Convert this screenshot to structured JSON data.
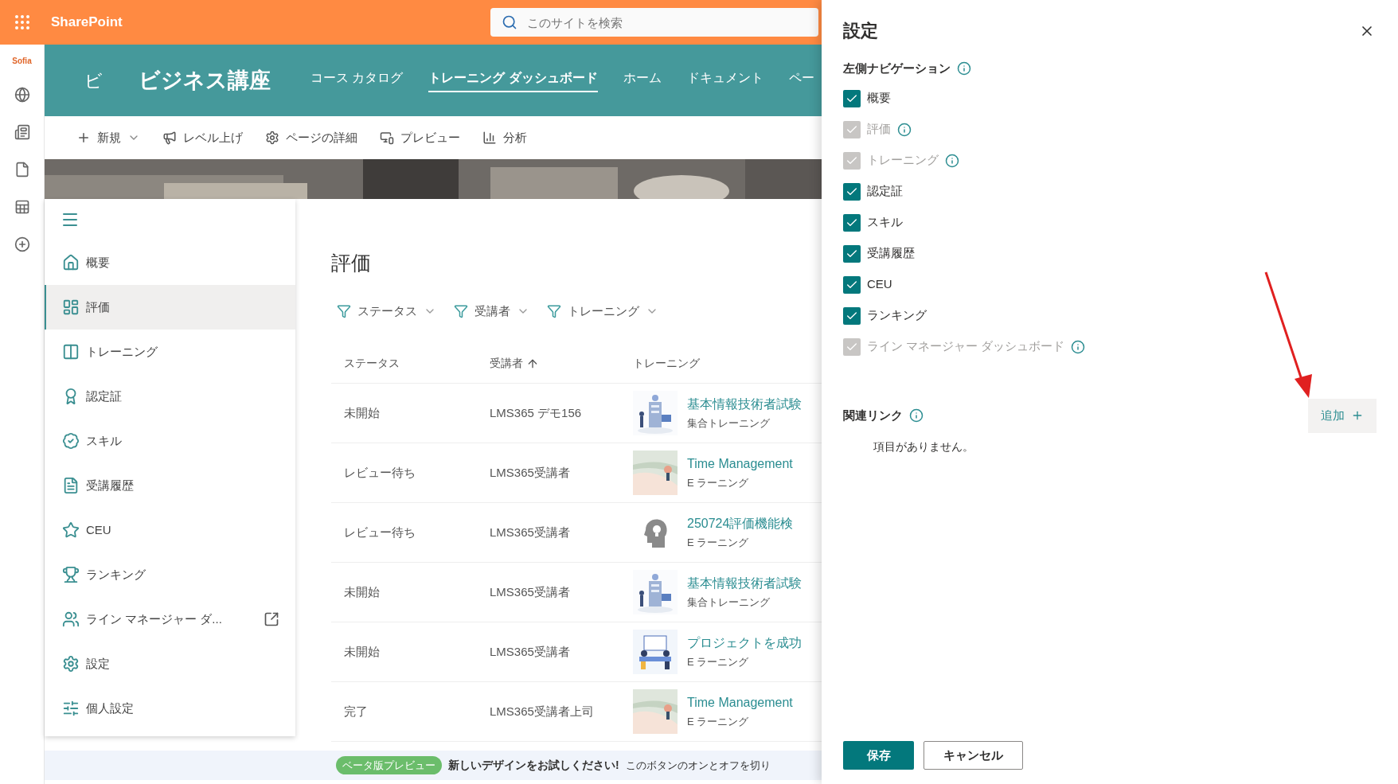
{
  "app_bar": {
    "product": "SharePoint",
    "search_placeholder": "このサイトを検索"
  },
  "rail": {
    "logo": "Sofia"
  },
  "site": {
    "logo_letter": "ビ",
    "title": "ビジネス講座",
    "nav": [
      {
        "label": "コース カタログ",
        "selected": false
      },
      {
        "label": "トレーニング ダッシュボード",
        "selected": true
      },
      {
        "label": "ホーム",
        "selected": false
      },
      {
        "label": "ドキュメント",
        "selected": false
      },
      {
        "label": "ペー",
        "selected": false
      }
    ]
  },
  "command_bar": [
    {
      "label": "新規",
      "dropdown": true
    },
    {
      "label": "レベル上げ",
      "dropdown": false
    },
    {
      "label": "ページの詳細",
      "dropdown": false
    },
    {
      "label": "プレビュー",
      "dropdown": false
    },
    {
      "label": "分析",
      "dropdown": false
    }
  ],
  "left_nav": {
    "items": [
      {
        "label": "概要",
        "selected": false,
        "external": false
      },
      {
        "label": "評価",
        "selected": true,
        "external": false
      },
      {
        "label": "トレーニング",
        "selected": false,
        "external": false
      },
      {
        "label": "認定証",
        "selected": false,
        "external": false
      },
      {
        "label": "スキル",
        "selected": false,
        "external": false
      },
      {
        "label": "受講履歴",
        "selected": false,
        "external": false
      },
      {
        "label": "CEU",
        "selected": false,
        "external": false
      },
      {
        "label": "ランキング",
        "selected": false,
        "external": false
      },
      {
        "label": "ライン マネージャー ダ...",
        "selected": false,
        "external": true
      },
      {
        "label": "設定",
        "selected": false,
        "external": false
      },
      {
        "label": "個人設定",
        "selected": false,
        "external": false
      }
    ]
  },
  "content": {
    "title": "評価",
    "filters": [
      "ステータス",
      "受講者",
      "トレーニング"
    ],
    "columns": [
      {
        "label": "ステータス",
        "sorted": false
      },
      {
        "label": "受講者",
        "sorted": true
      },
      {
        "label": "トレーニング",
        "sorted": false
      }
    ],
    "rows": [
      {
        "status": "未開始",
        "learner": "LMS365 デモ156",
        "training": "基本情報技術者試験",
        "type": "集合トレーニング"
      },
      {
        "status": "レビュー待ち",
        "learner": "LMS365受講者",
        "training": "Time Management",
        "type": "E ラーニング"
      },
      {
        "status": "レビュー待ち",
        "learner": "LMS365受講者",
        "training": "250724評価機能検",
        "type": "E ラーニング",
        "thumbnail": {
          "kind": "icon"
        }
      },
      {
        "status": "未開始",
        "learner": "LMS365受講者",
        "training": "基本情報技術者試験",
        "type": "集合トレーニング"
      },
      {
        "status": "未開始",
        "learner": "LMS365受講者",
        "training": "プロジェクトを成功",
        "type": "E ラーニング"
      },
      {
        "status": "完了",
        "learner": "LMS365受講者上司",
        "training": "Time Management",
        "type": "E ラーニング"
      }
    ]
  },
  "beta_bar": {
    "badge": "ベータ版プレビュー",
    "headline": "新しいデザインをお試しください!",
    "text": "このボタンのオンとオフを切り"
  },
  "panel": {
    "title": "設定",
    "left_nav_section": {
      "title": "左側ナビゲーション",
      "items": [
        {
          "label": "概要",
          "checked": true,
          "disabled": false,
          "info": false
        },
        {
          "label": "評価",
          "checked": true,
          "disabled": true,
          "info": true
        },
        {
          "label": "トレーニング",
          "checked": true,
          "disabled": true,
          "info": true
        },
        {
          "label": "認定証",
          "checked": true,
          "disabled": false,
          "info": false
        },
        {
          "label": "スキル",
          "checked": true,
          "disabled": false,
          "info": false
        },
        {
          "label": "受講履歴",
          "checked": true,
          "disabled": false,
          "info": false
        },
        {
          "label": "CEU",
          "checked": true,
          "disabled": false,
          "info": false
        },
        {
          "label": "ランキング",
          "checked": true,
          "disabled": false,
          "info": false
        },
        {
          "label": "ライン マネージャー ダッシュボード",
          "checked": true,
          "disabled": true,
          "info": true
        }
      ]
    },
    "related_links": {
      "title": "関連リンク",
      "add_label": "追加",
      "empty_text": "項目がありません。"
    },
    "buttons": {
      "save": "保存",
      "cancel": "キャンセル"
    }
  }
}
